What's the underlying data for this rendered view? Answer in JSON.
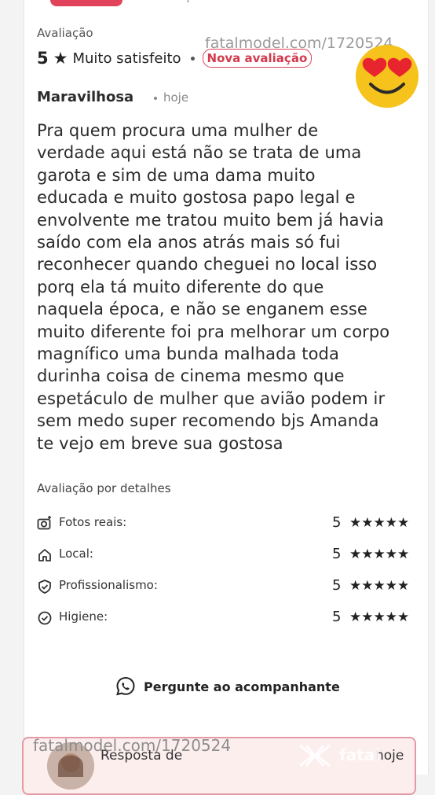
{
  "review": {
    "section_label": "Avaliação",
    "score": "5",
    "score_star": "★",
    "satisfaction": "Muito satisfeito",
    "badge": "Nova avaliação",
    "author": "Maravilhosa",
    "time": "hoje",
    "text_lines": [
      "Pra quem procura uma mulher de",
      "verdade aqui está não se trata de uma",
      "garota e sim de uma dama muito",
      "educada e muito gostosa papo legal e",
      "envolvente me tratou muito bem já havia",
      "saído com ela anos atrás mais só fui",
      "reconhecer quando cheguei no local isso",
      "porq ela tá muito diferente do que",
      "naquela época, e não se enganem esse",
      "muito diferente foi pra melhorar um corpo",
      "magnífico uma bunda malhada toda",
      "durinha coisa de cinema mesmo que",
      "espetáculo de mulher que avião podem ir",
      "sem medo super recomendo bjs Amanda",
      "te vejo em breve sua gostosa"
    ]
  },
  "details": {
    "title": "Avaliação por detalhes",
    "items": [
      {
        "label": "Fotos reais:",
        "value": "5",
        "stars": "★★★★★",
        "icon": "camera-icon"
      },
      {
        "label": "Local:",
        "value": "5",
        "stars": "★★★★★",
        "icon": "home-icon"
      },
      {
        "label": "Profissionalismo:",
        "value": "5",
        "stars": "★★★★★",
        "icon": "shield-check-icon"
      },
      {
        "label": "Higiene:",
        "value": "5",
        "stars": "★★★★★",
        "icon": "check-circle-icon"
      }
    ]
  },
  "ask_button": {
    "label": "Pergunte ao acompanhante",
    "icon": "whatsapp-icon"
  },
  "reply": {
    "label": "Resposta de",
    "time": "hoje"
  },
  "watermarks": {
    "top": "fatalmodel.com/1720524",
    "bottom": "fatalmodel.com/1720524",
    "logo": "fatal"
  },
  "colors": {
    "accent": "#e0435a",
    "emoji_face": "#f6c21c",
    "emoji_hearts": "#e8242e"
  }
}
